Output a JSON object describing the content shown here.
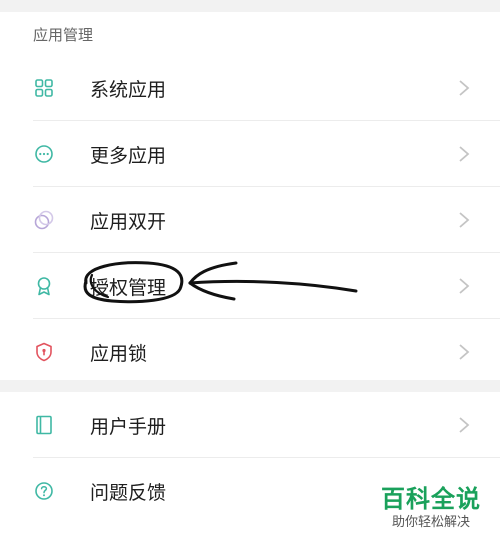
{
  "section_header": "应用管理",
  "items": [
    {
      "label": "系统应用",
      "icon": "grid-icon"
    },
    {
      "label": "更多应用",
      "icon": "more-dots-icon"
    },
    {
      "label": "应用双开",
      "icon": "dual-circles-icon"
    },
    {
      "label": "授权管理",
      "icon": "award-ribbon-icon"
    },
    {
      "label": "应用锁",
      "icon": "shield-lock-icon"
    },
    {
      "label": "用户手册",
      "icon": "book-icon"
    },
    {
      "label": "问题反馈",
      "icon": "question-circle-icon"
    }
  ],
  "watermark": {
    "title": "百科全说",
    "subtitle": "助你轻松解决"
  },
  "colors": {
    "icon_accent": "#3fb8a4",
    "shield": "#e2535e",
    "watermark_green": "#1aa15b"
  }
}
